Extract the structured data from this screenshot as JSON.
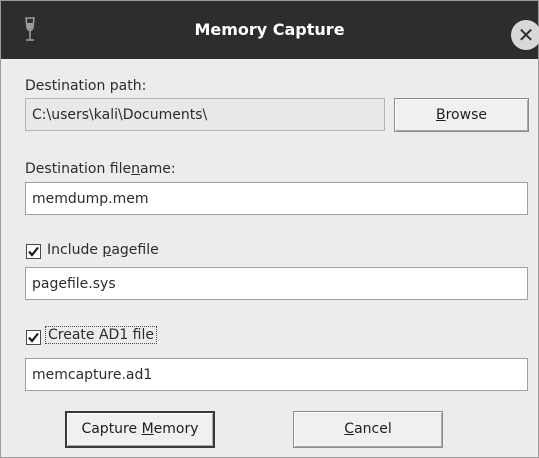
{
  "window": {
    "title": "Memory Capture",
    "close_glyph": "✕"
  },
  "destination_path": {
    "label": "Destination path:",
    "value": "C:\\users\\kali\\Documents\\",
    "browse_label_pre": "",
    "browse_label_mnemonic": "B",
    "browse_label_post": "rowse"
  },
  "destination_filename": {
    "label_pre": "Destination file",
    "label_mnemonic": "n",
    "label_post": "ame:",
    "value": "memdump.mem"
  },
  "pagefile": {
    "checked": true,
    "label_pre": "Include ",
    "label_mnemonic": "p",
    "label_post": "agefile",
    "value": "pagefile.sys"
  },
  "ad1": {
    "checked": true,
    "label": "Create AD1 file",
    "value": "memcapture.ad1"
  },
  "buttons": {
    "capture_pre": "Capture ",
    "capture_mnemonic": "M",
    "capture_post": "emory",
    "cancel_pre": "",
    "cancel_mnemonic": "C",
    "cancel_post": "ancel"
  },
  "icons": {
    "app": "wine-glass-icon",
    "close": "close-icon",
    "check": "check-icon"
  },
  "colors": {
    "titlebar": "#2d2d2d",
    "window_bg": "#ececec"
  }
}
